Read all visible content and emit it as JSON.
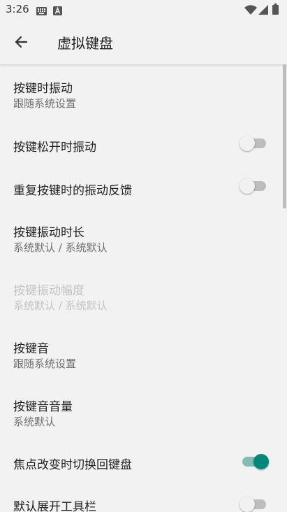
{
  "status_bar": {
    "time": "3:26",
    "icons": [
      "keyboard-icon",
      "text-a-icon",
      "wifi-icon",
      "signal-icon",
      "battery-icon"
    ]
  },
  "app_bar": {
    "title": "虚拟键盘",
    "back_icon": "arrow-left-icon"
  },
  "settings": [
    {
      "title": "按键时振动",
      "subtitle": "跟随系统设置"
    },
    {
      "title": "按键松开时振动",
      "switch_on": false
    },
    {
      "title": "重复按键时的振动反馈",
      "switch_on": false
    },
    {
      "title": "按键振动时长",
      "subtitle": "系统默认 / 系统默认"
    },
    {
      "title": "按键振动幅度",
      "subtitle": "系统默认 / 系统默认",
      "enabled": false
    },
    {
      "title": "按键音",
      "subtitle": "跟随系统设置"
    },
    {
      "title": "按键音音量",
      "subtitle": "系统默认"
    },
    {
      "title": "焦点改变时切换回键盘",
      "switch_on": true
    },
    {
      "title": "默认展开工具栏",
      "switch_on": false
    }
  ],
  "colors": {
    "background": "#f2f2f2",
    "accent": "#00897b",
    "text_primary": "#212121",
    "text_secondary": "#6f6f6f",
    "text_disabled": "#c4c4c4"
  }
}
